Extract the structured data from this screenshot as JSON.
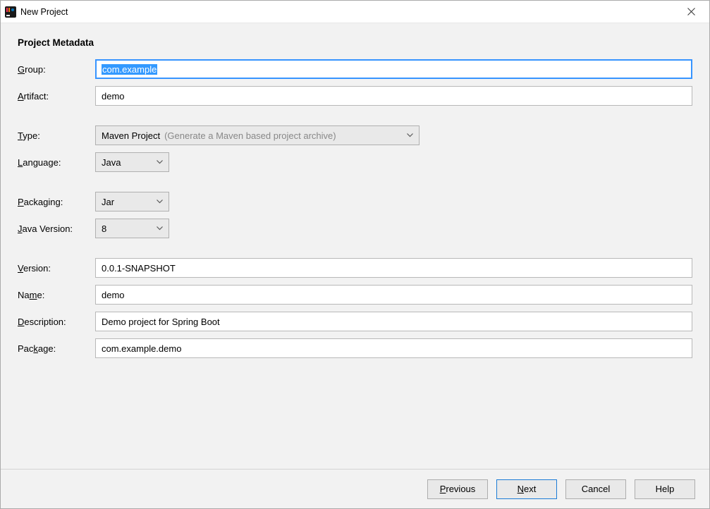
{
  "window": {
    "title": "New Project"
  },
  "section_title": "Project Metadata",
  "labels": {
    "group": "Group:",
    "artifact": "Artifact:",
    "type": "Type:",
    "language": "Language:",
    "packaging": "Packaging:",
    "java_version": "Java Version:",
    "version": "Version:",
    "name": "Name:",
    "description": "Description:",
    "package": "Package:"
  },
  "mnemonics": {
    "group": "G",
    "artifact": "A",
    "type": "T",
    "language": "L",
    "packaging": "P",
    "java_version": "J",
    "version": "V",
    "name": "m",
    "description": "D",
    "package": "k"
  },
  "values": {
    "group": "com.example",
    "artifact": "demo",
    "type": "Maven Project",
    "type_hint": "(Generate a Maven based project archive)",
    "language": "Java",
    "packaging": "Jar",
    "java_version": "8",
    "version": "0.0.1-SNAPSHOT",
    "name": "demo",
    "description": "Demo project for Spring Boot",
    "package": "com.example.demo"
  },
  "buttons": {
    "previous": "Previous",
    "next": "Next",
    "cancel": "Cancel",
    "help": "Help"
  },
  "button_mnemonics": {
    "previous": "P",
    "next": "N"
  }
}
